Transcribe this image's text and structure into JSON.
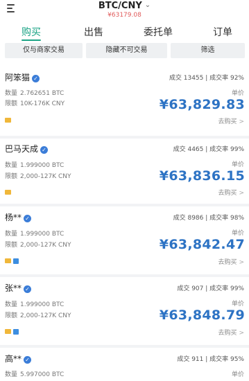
{
  "header": {
    "pair": "BTC/CNY",
    "ref_price": "¥63179.08"
  },
  "tabs": [
    {
      "label": "购买",
      "active": true
    },
    {
      "label": "出售",
      "active": false
    },
    {
      "label": "委托单",
      "active": false
    },
    {
      "label": "订单",
      "active": false
    }
  ],
  "filters": [
    {
      "label": "仅与商家交易"
    },
    {
      "label": "隐藏不可交易"
    },
    {
      "label": "筛选"
    }
  ],
  "labels": {
    "qty": "数量",
    "limit": "限额",
    "unit_price": "单价",
    "buy": "去购买"
  },
  "colors": {
    "accent": "#1aa385",
    "price": "#2d73c4",
    "ref_price": "#e05a5a",
    "verified": "#3b7dd8"
  },
  "listings": [
    {
      "name": "阿笨猫",
      "stats": "成交 13455 | 成交率 92%",
      "qty": "2.762651 BTC",
      "limit": "10K-176K CNY",
      "price": "¥63,829.83",
      "payments": [
        "bank-icon"
      ]
    },
    {
      "name": "巴马天成",
      "stats": "成交 4465 | 成交率 99%",
      "qty": "1.999000 BTC",
      "limit": "2,000-127K CNY",
      "price": "¥63,836.15",
      "payments": [
        "bank-icon"
      ]
    },
    {
      "name": "杨**",
      "stats": "成交 8986 | 成交率 98%",
      "qty": "1.999000 BTC",
      "limit": "2,000-127K CNY",
      "price": "¥63,842.47",
      "payments": [
        "bank-icon",
        "alipay-icon"
      ]
    },
    {
      "name": "张**",
      "stats": "成交 907 | 成交率 99%",
      "qty": "1.999000 BTC",
      "limit": "2,000-127K CNY",
      "price": "¥63,848.79",
      "payments": [
        "bank-icon",
        "alipay-icon"
      ]
    },
    {
      "name": "高**",
      "stats": "成交 911 | 成交率 95%",
      "qty": "5.997000 BTC",
      "limit": "",
      "price": "",
      "payments": []
    }
  ]
}
